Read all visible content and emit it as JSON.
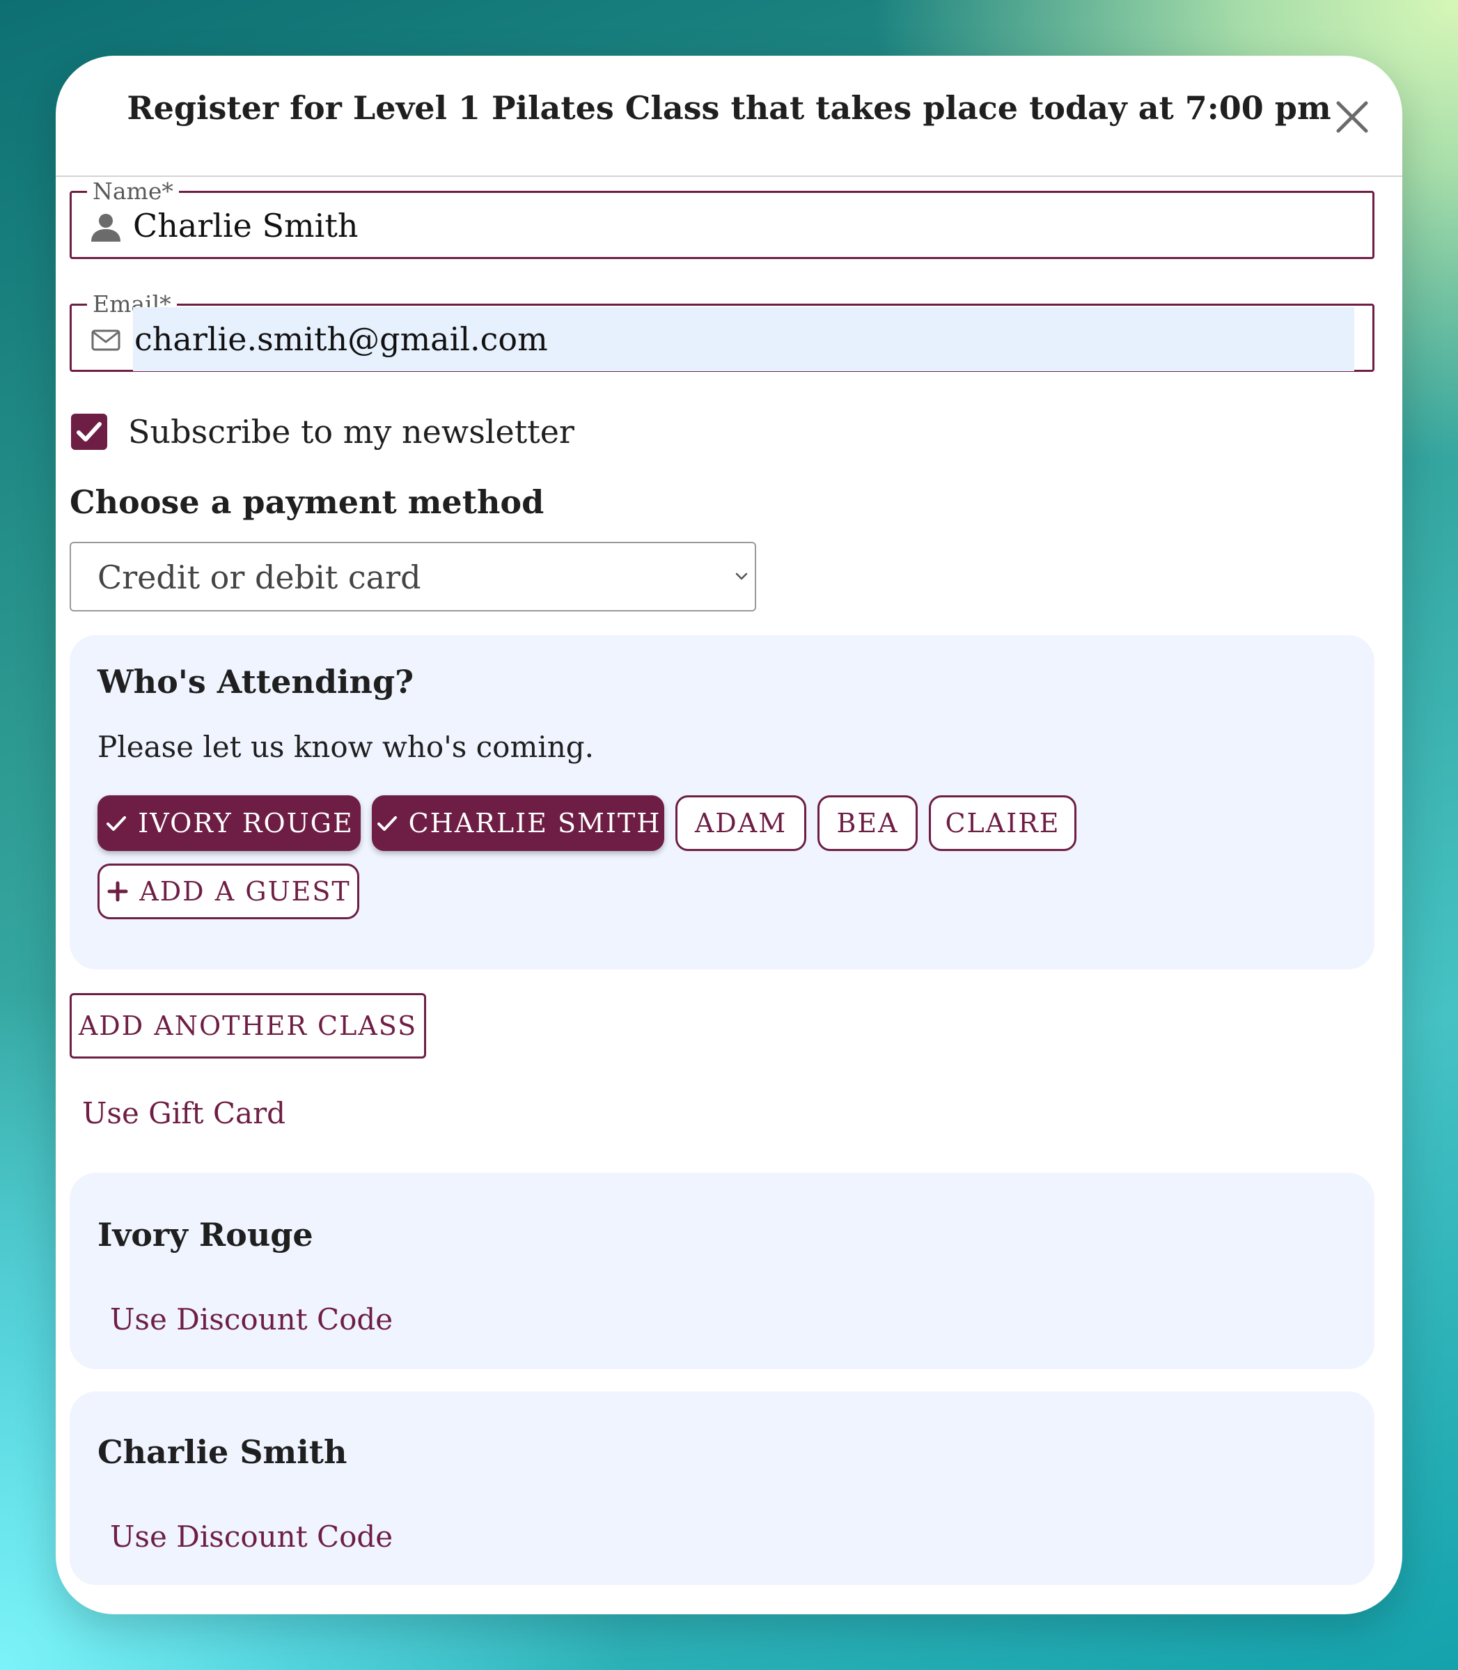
{
  "modal": {
    "title": "Register for Level 1 Pilates Class that takes place today at 7:00 pm",
    "close_icon": "close-icon"
  },
  "form": {
    "name": {
      "label": "Name*",
      "value": "Charlie Smith",
      "icon": "person-icon"
    },
    "email": {
      "label": "Email*",
      "value": "charlie.smith@gmail.com",
      "icon": "envelope-icon"
    },
    "newsletter": {
      "label": "Subscribe to my newsletter",
      "checked": true
    },
    "payment": {
      "heading": "Choose a payment method",
      "selected": "Credit or debit card"
    }
  },
  "attending": {
    "title": "Who's Attending?",
    "description": "Please let us know who's coming.",
    "attendees": [
      {
        "label": "IVORY ROUGE",
        "selected": true
      },
      {
        "label": "CHARLIE SMITH",
        "selected": true
      },
      {
        "label": "ADAM",
        "selected": false
      },
      {
        "label": "BEA",
        "selected": false
      },
      {
        "label": "CLAIRE",
        "selected": false
      }
    ],
    "add_guest_label": "ADD A GUEST"
  },
  "actions": {
    "add_class_label": "ADD ANOTHER CLASS",
    "gift_card_label": "Use Gift Card"
  },
  "discounts": [
    {
      "name": "Ivory Rouge",
      "link": "Use Discount Code"
    },
    {
      "name": "Charlie Smith",
      "link": "Use Discount Code"
    }
  ],
  "colors": {
    "accent": "#6e1e44",
    "panel": "#eff4fe",
    "autofill": "#e7f0fd"
  }
}
